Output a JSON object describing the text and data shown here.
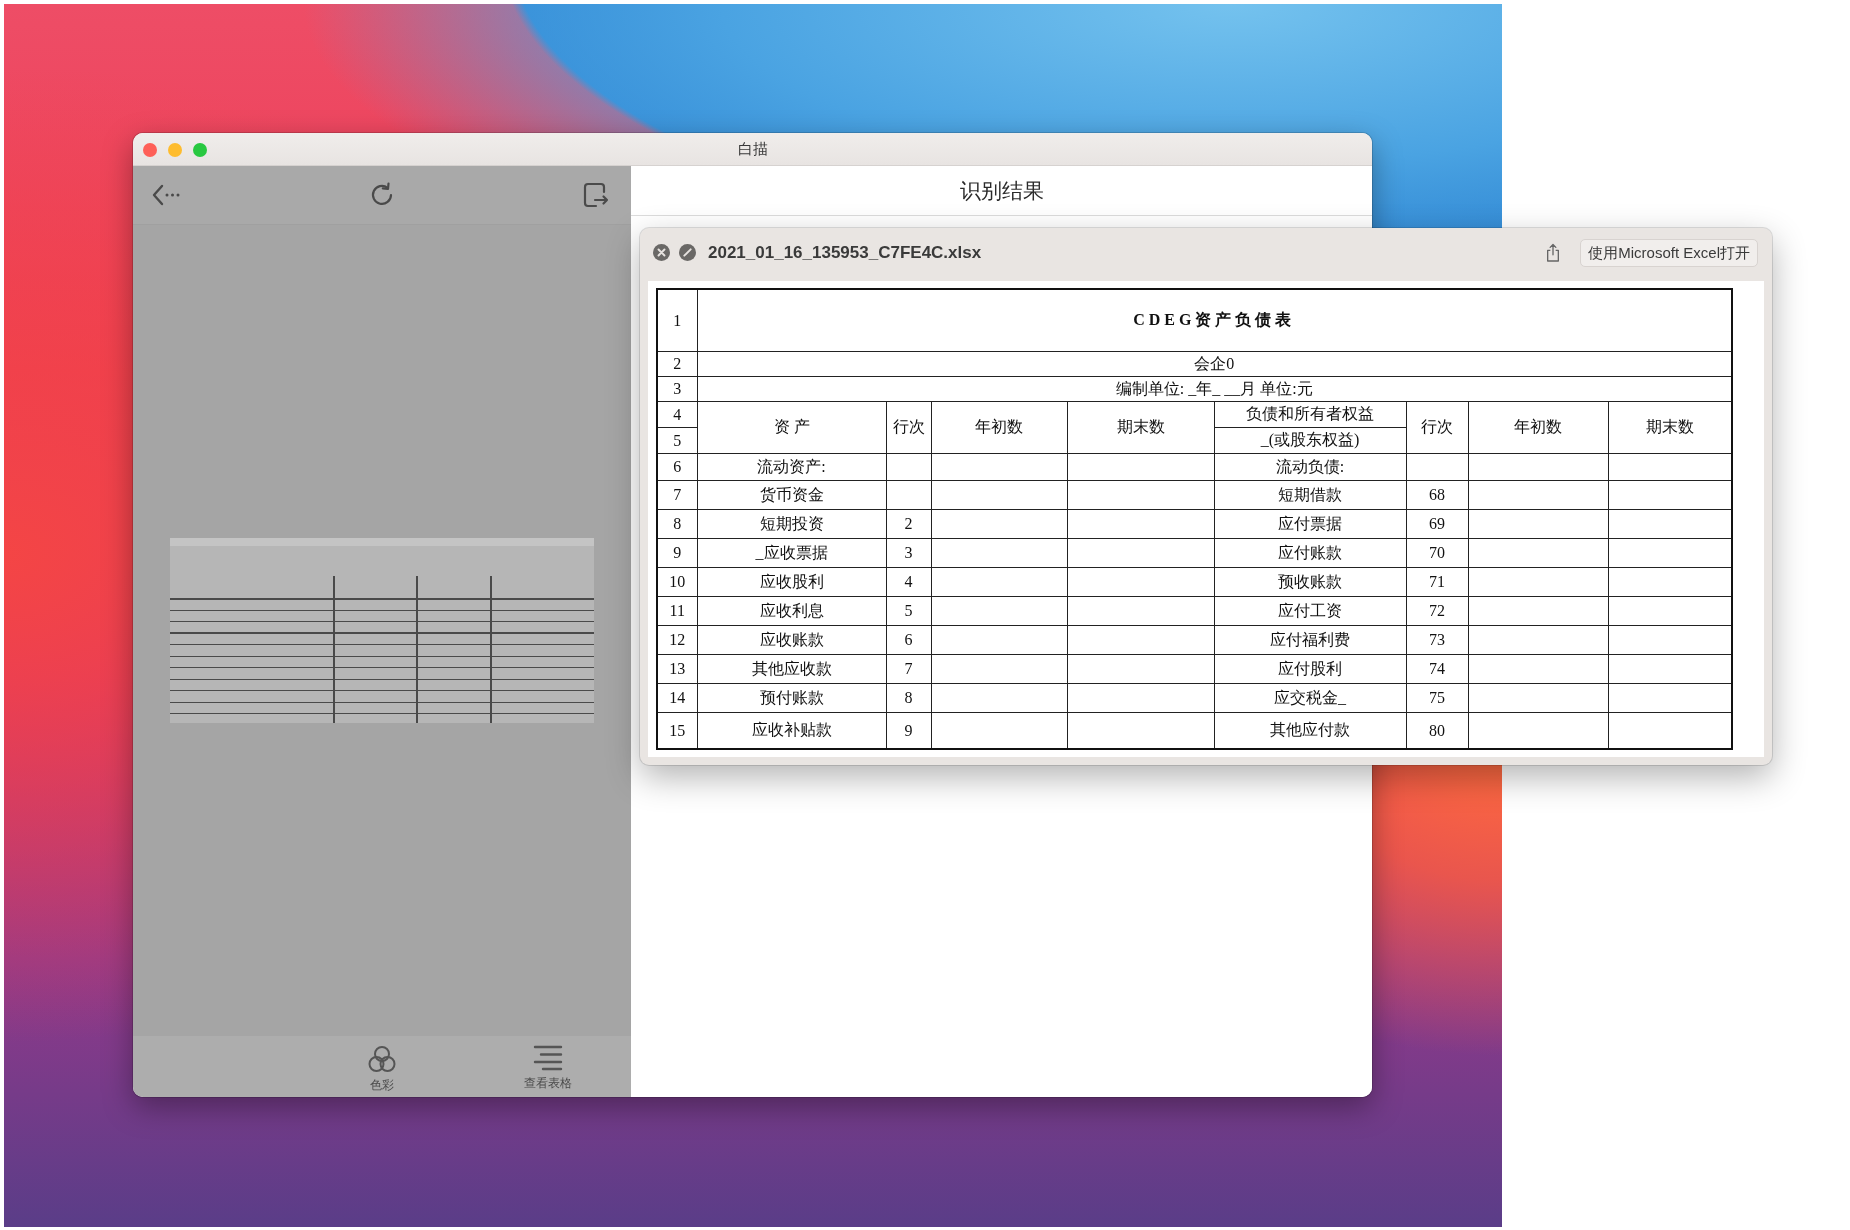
{
  "window": {
    "title": "白描"
  },
  "left_panel": {
    "bottom_bar": [
      {
        "kind": "color",
        "label": "色彩"
      },
      {
        "kind": "table",
        "label": "查看表格"
      }
    ]
  },
  "right_panel": {
    "title": "识别结果"
  },
  "preview": {
    "file_name": "2021_01_16_135953_C7FE4C.xlsx",
    "open_button": "使用Microsoft Excel打开",
    "sheet": {
      "title_row": {
        "num": "1",
        "text": "CDEG资产负债表"
      },
      "info_rows": [
        {
          "num": "2",
          "text": "会企0"
        },
        {
          "num": "3",
          "text": "编制单位: _年_ __月 单位:元"
        }
      ],
      "header": {
        "nums": [
          "4",
          "5"
        ],
        "asset": "资 产",
        "line": "行次",
        "begin": "年初数",
        "end": "期末数",
        "liability_top": "负债和所有者权益",
        "liability_bottom": "_(或股东权益)",
        "line_2": "行次",
        "begin_2": "年初数",
        "end_2": "期末数"
      },
      "rows": [
        {
          "num": "6",
          "asset": "流动资产:",
          "liability": "流动负债:"
        },
        {
          "num": "7",
          "asset": "货币资金",
          "liability": "短期借款",
          "liability_line": "68"
        },
        {
          "num": "8",
          "asset": "短期投资",
          "asset_line": "2",
          "liability": "应付票据",
          "liability_line": "69"
        },
        {
          "num": "9",
          "asset": "_应收票据",
          "asset_line": "3",
          "liability": "应付账款",
          "liability_line": "70"
        },
        {
          "num": "10",
          "asset": "应收股利",
          "asset_line": "4",
          "liability": "预收账款",
          "liability_line": "71"
        },
        {
          "num": "11",
          "asset": "应收利息",
          "asset_line": "5",
          "liability": "应付工资",
          "liability_line": "72"
        },
        {
          "num": "12",
          "asset": "应收账款",
          "asset_line": "6",
          "liability": "应付福利费",
          "liability_line": "73"
        },
        {
          "num": "13",
          "asset": "其他应收款",
          "asset_line": "7",
          "liability": "应付股利",
          "liability_line": "74"
        },
        {
          "num": "14",
          "asset": "预付账款",
          "asset_line": "8",
          "liability": "应交税金_",
          "liability_line": "75"
        },
        {
          "num": "15",
          "asset": "应收补贴款",
          "asset_line": "9",
          "liability": "其他应付款",
          "liability_line": "80"
        }
      ]
    }
  }
}
